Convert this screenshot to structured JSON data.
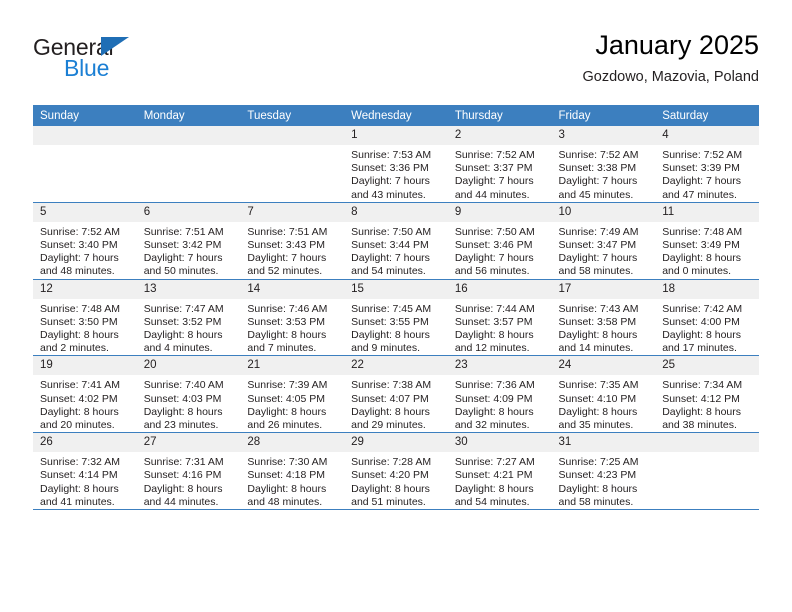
{
  "brand": {
    "name_part1": "General",
    "name_part2": "Blue",
    "triangle_color": "#1f6eb5",
    "blue_color": "#1b7fd4"
  },
  "header": {
    "title": "January 2025",
    "subtitle": "Gozdowo, Mazovia, Poland"
  },
  "theme": {
    "header_band": "#3c7fbf",
    "daynum_band": "#f0f0f0",
    "text": "#231f20"
  },
  "weekday_headers": [
    "Sunday",
    "Monday",
    "Tuesday",
    "Wednesday",
    "Thursday",
    "Friday",
    "Saturday"
  ],
  "weeks": [
    [
      {
        "day": "",
        "empty": true,
        "sunrise": "",
        "sunset": "",
        "daylight1": "",
        "daylight2": ""
      },
      {
        "day": "",
        "empty": true,
        "sunrise": "",
        "sunset": "",
        "daylight1": "",
        "daylight2": ""
      },
      {
        "day": "",
        "empty": true,
        "sunrise": "",
        "sunset": "",
        "daylight1": "",
        "daylight2": ""
      },
      {
        "day": "1",
        "empty": false,
        "sunrise": "Sunrise: 7:53 AM",
        "sunset": "Sunset: 3:36 PM",
        "daylight1": "Daylight: 7 hours",
        "daylight2": "and 43 minutes."
      },
      {
        "day": "2",
        "empty": false,
        "sunrise": "Sunrise: 7:52 AM",
        "sunset": "Sunset: 3:37 PM",
        "daylight1": "Daylight: 7 hours",
        "daylight2": "and 44 minutes."
      },
      {
        "day": "3",
        "empty": false,
        "sunrise": "Sunrise: 7:52 AM",
        "sunset": "Sunset: 3:38 PM",
        "daylight1": "Daylight: 7 hours",
        "daylight2": "and 45 minutes."
      },
      {
        "day": "4",
        "empty": false,
        "sunrise": "Sunrise: 7:52 AM",
        "sunset": "Sunset: 3:39 PM",
        "daylight1": "Daylight: 7 hours",
        "daylight2": "and 47 minutes."
      }
    ],
    [
      {
        "day": "5",
        "empty": false,
        "sunrise": "Sunrise: 7:52 AM",
        "sunset": "Sunset: 3:40 PM",
        "daylight1": "Daylight: 7 hours",
        "daylight2": "and 48 minutes."
      },
      {
        "day": "6",
        "empty": false,
        "sunrise": "Sunrise: 7:51 AM",
        "sunset": "Sunset: 3:42 PM",
        "daylight1": "Daylight: 7 hours",
        "daylight2": "and 50 minutes."
      },
      {
        "day": "7",
        "empty": false,
        "sunrise": "Sunrise: 7:51 AM",
        "sunset": "Sunset: 3:43 PM",
        "daylight1": "Daylight: 7 hours",
        "daylight2": "and 52 minutes."
      },
      {
        "day": "8",
        "empty": false,
        "sunrise": "Sunrise: 7:50 AM",
        "sunset": "Sunset: 3:44 PM",
        "daylight1": "Daylight: 7 hours",
        "daylight2": "and 54 minutes."
      },
      {
        "day": "9",
        "empty": false,
        "sunrise": "Sunrise: 7:50 AM",
        "sunset": "Sunset: 3:46 PM",
        "daylight1": "Daylight: 7 hours",
        "daylight2": "and 56 minutes."
      },
      {
        "day": "10",
        "empty": false,
        "sunrise": "Sunrise: 7:49 AM",
        "sunset": "Sunset: 3:47 PM",
        "daylight1": "Daylight: 7 hours",
        "daylight2": "and 58 minutes."
      },
      {
        "day": "11",
        "empty": false,
        "sunrise": "Sunrise: 7:48 AM",
        "sunset": "Sunset: 3:49 PM",
        "daylight1": "Daylight: 8 hours",
        "daylight2": "and 0 minutes."
      }
    ],
    [
      {
        "day": "12",
        "empty": false,
        "sunrise": "Sunrise: 7:48 AM",
        "sunset": "Sunset: 3:50 PM",
        "daylight1": "Daylight: 8 hours",
        "daylight2": "and 2 minutes."
      },
      {
        "day": "13",
        "empty": false,
        "sunrise": "Sunrise: 7:47 AM",
        "sunset": "Sunset: 3:52 PM",
        "daylight1": "Daylight: 8 hours",
        "daylight2": "and 4 minutes."
      },
      {
        "day": "14",
        "empty": false,
        "sunrise": "Sunrise: 7:46 AM",
        "sunset": "Sunset: 3:53 PM",
        "daylight1": "Daylight: 8 hours",
        "daylight2": "and 7 minutes."
      },
      {
        "day": "15",
        "empty": false,
        "sunrise": "Sunrise: 7:45 AM",
        "sunset": "Sunset: 3:55 PM",
        "daylight1": "Daylight: 8 hours",
        "daylight2": "and 9 minutes."
      },
      {
        "day": "16",
        "empty": false,
        "sunrise": "Sunrise: 7:44 AM",
        "sunset": "Sunset: 3:57 PM",
        "daylight1": "Daylight: 8 hours",
        "daylight2": "and 12 minutes."
      },
      {
        "day": "17",
        "empty": false,
        "sunrise": "Sunrise: 7:43 AM",
        "sunset": "Sunset: 3:58 PM",
        "daylight1": "Daylight: 8 hours",
        "daylight2": "and 14 minutes."
      },
      {
        "day": "18",
        "empty": false,
        "sunrise": "Sunrise: 7:42 AM",
        "sunset": "Sunset: 4:00 PM",
        "daylight1": "Daylight: 8 hours",
        "daylight2": "and 17 minutes."
      }
    ],
    [
      {
        "day": "19",
        "empty": false,
        "sunrise": "Sunrise: 7:41 AM",
        "sunset": "Sunset: 4:02 PM",
        "daylight1": "Daylight: 8 hours",
        "daylight2": "and 20 minutes."
      },
      {
        "day": "20",
        "empty": false,
        "sunrise": "Sunrise: 7:40 AM",
        "sunset": "Sunset: 4:03 PM",
        "daylight1": "Daylight: 8 hours",
        "daylight2": "and 23 minutes."
      },
      {
        "day": "21",
        "empty": false,
        "sunrise": "Sunrise: 7:39 AM",
        "sunset": "Sunset: 4:05 PM",
        "daylight1": "Daylight: 8 hours",
        "daylight2": "and 26 minutes."
      },
      {
        "day": "22",
        "empty": false,
        "sunrise": "Sunrise: 7:38 AM",
        "sunset": "Sunset: 4:07 PM",
        "daylight1": "Daylight: 8 hours",
        "daylight2": "and 29 minutes."
      },
      {
        "day": "23",
        "empty": false,
        "sunrise": "Sunrise: 7:36 AM",
        "sunset": "Sunset: 4:09 PM",
        "daylight1": "Daylight: 8 hours",
        "daylight2": "and 32 minutes."
      },
      {
        "day": "24",
        "empty": false,
        "sunrise": "Sunrise: 7:35 AM",
        "sunset": "Sunset: 4:10 PM",
        "daylight1": "Daylight: 8 hours",
        "daylight2": "and 35 minutes."
      },
      {
        "day": "25",
        "empty": false,
        "sunrise": "Sunrise: 7:34 AM",
        "sunset": "Sunset: 4:12 PM",
        "daylight1": "Daylight: 8 hours",
        "daylight2": "and 38 minutes."
      }
    ],
    [
      {
        "day": "26",
        "empty": false,
        "sunrise": "Sunrise: 7:32 AM",
        "sunset": "Sunset: 4:14 PM",
        "daylight1": "Daylight: 8 hours",
        "daylight2": "and 41 minutes."
      },
      {
        "day": "27",
        "empty": false,
        "sunrise": "Sunrise: 7:31 AM",
        "sunset": "Sunset: 4:16 PM",
        "daylight1": "Daylight: 8 hours",
        "daylight2": "and 44 minutes."
      },
      {
        "day": "28",
        "empty": false,
        "sunrise": "Sunrise: 7:30 AM",
        "sunset": "Sunset: 4:18 PM",
        "daylight1": "Daylight: 8 hours",
        "daylight2": "and 48 minutes."
      },
      {
        "day": "29",
        "empty": false,
        "sunrise": "Sunrise: 7:28 AM",
        "sunset": "Sunset: 4:20 PM",
        "daylight1": "Daylight: 8 hours",
        "daylight2": "and 51 minutes."
      },
      {
        "day": "30",
        "empty": false,
        "sunrise": "Sunrise: 7:27 AM",
        "sunset": "Sunset: 4:21 PM",
        "daylight1": "Daylight: 8 hours",
        "daylight2": "and 54 minutes."
      },
      {
        "day": "31",
        "empty": false,
        "sunrise": "Sunrise: 7:25 AM",
        "sunset": "Sunset: 4:23 PM",
        "daylight1": "Daylight: 8 hours",
        "daylight2": "and 58 minutes."
      },
      {
        "day": "",
        "empty": true,
        "sunrise": "",
        "sunset": "",
        "daylight1": "",
        "daylight2": ""
      }
    ]
  ]
}
